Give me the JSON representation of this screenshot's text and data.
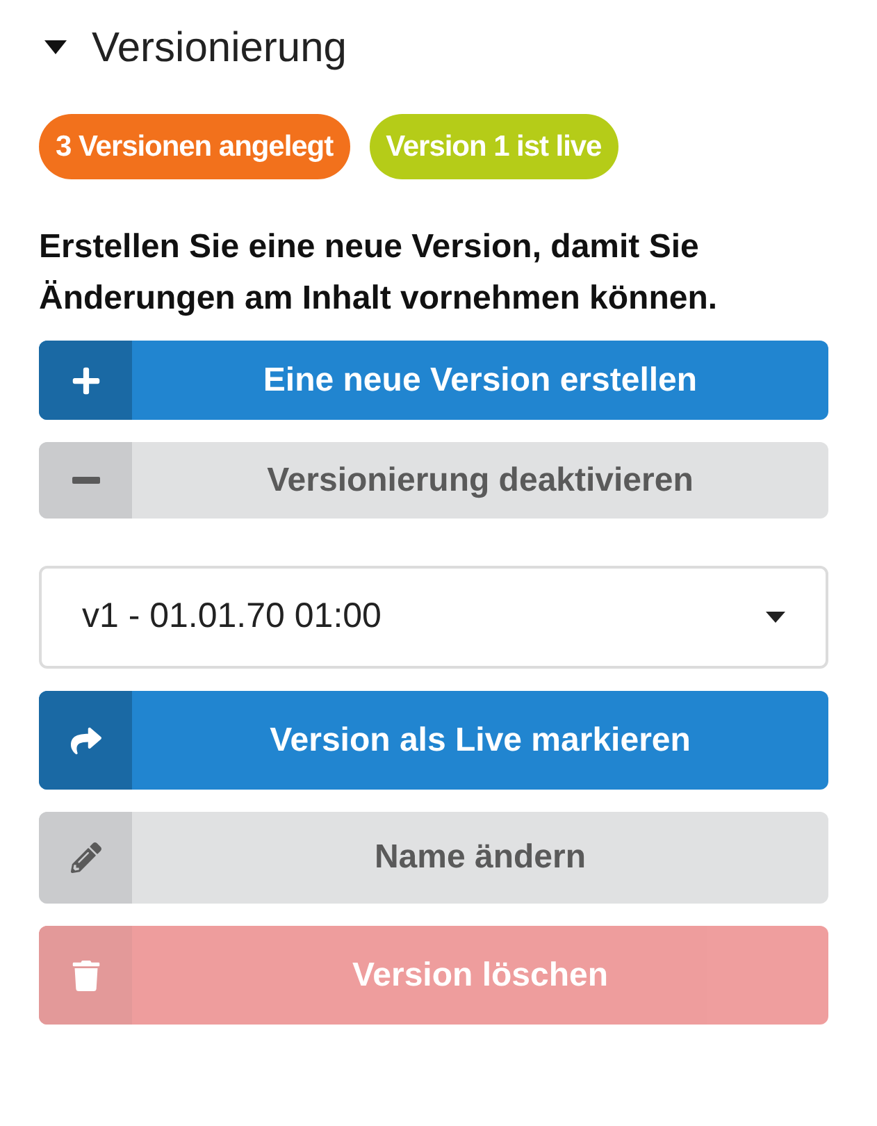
{
  "section": {
    "title": "Versionierung",
    "expanded": true
  },
  "badges": [
    {
      "label": "3 Versionen angelegt",
      "color": "#f2711c"
    },
    {
      "label": "Version 1 ist live",
      "color": "#b5cc18"
    }
  ],
  "instruction": "Erstellen Sie eine neue Version, damit Sie Änderungen am Inhalt vornehmen können.",
  "top_buttons": [
    {
      "label": "Eine neue Version erstellen",
      "kind": "primary",
      "disabled": false
    },
    {
      "label": "Versionierung deaktivieren",
      "kind": "secondary",
      "disabled": false
    }
  ],
  "version_select": {
    "value": "v1 - 01.01.70 01:00"
  },
  "bottom_buttons": [
    {
      "label": "Version als Live markieren",
      "kind": "primary",
      "disabled": false
    },
    {
      "label": "Name ändern",
      "kind": "secondary",
      "disabled": false
    },
    {
      "label": "Version löschen",
      "kind": "danger",
      "disabled": true
    }
  ]
}
